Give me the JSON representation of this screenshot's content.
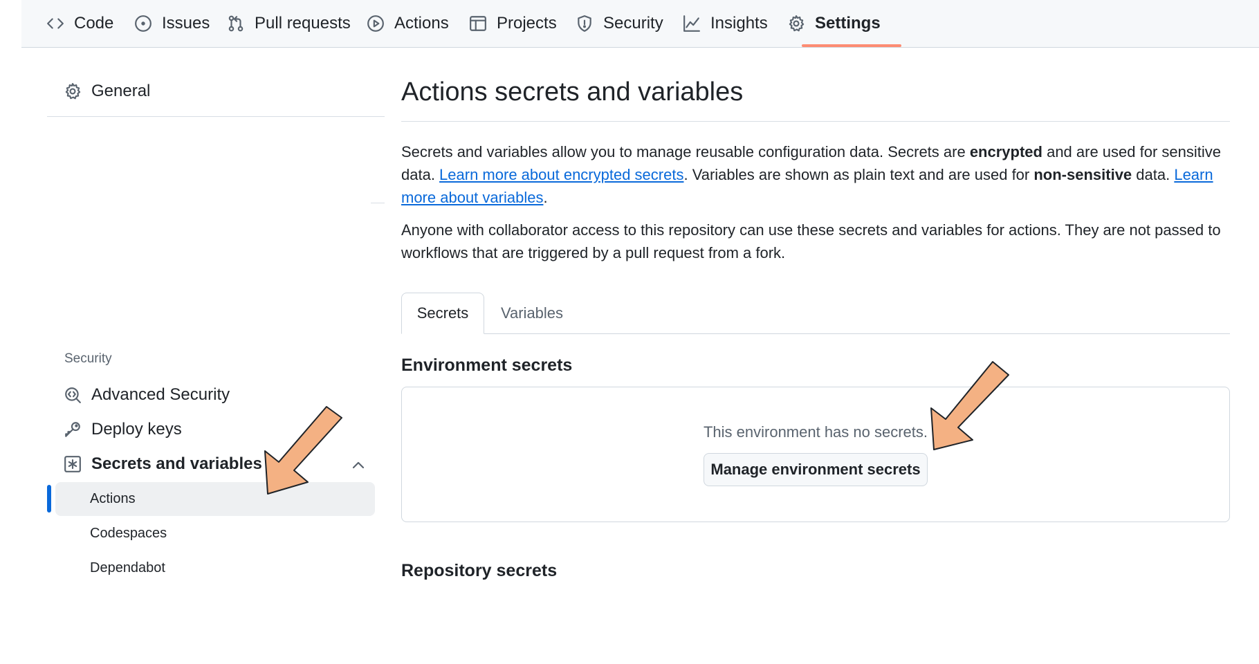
{
  "nav": {
    "items": [
      {
        "label": "Code",
        "icon": "code-icon"
      },
      {
        "label": "Issues",
        "icon": "issue-icon"
      },
      {
        "label": "Pull requests",
        "icon": "pull-request-icon"
      },
      {
        "label": "Actions",
        "icon": "play-icon"
      },
      {
        "label": "Projects",
        "icon": "table-icon"
      },
      {
        "label": "Security",
        "icon": "shield-icon"
      },
      {
        "label": "Insights",
        "icon": "graph-icon"
      },
      {
        "label": "Settings",
        "icon": "gear-icon",
        "selected": true
      }
    ],
    "selected_underline_color": "#fd8c73"
  },
  "sidebar": {
    "general": "General",
    "security_heading": "Security",
    "items": [
      {
        "label": "Advanced Security",
        "icon": "codescan-icon"
      },
      {
        "label": "Deploy keys",
        "icon": "key-icon"
      },
      {
        "label": "Secrets and variables",
        "icon": "asterisk-box-icon",
        "expanded": true
      }
    ],
    "subitems": [
      {
        "label": "Actions",
        "active": true
      },
      {
        "label": "Codespaces"
      },
      {
        "label": "Dependabot"
      }
    ]
  },
  "main": {
    "title": "Actions secrets and variables",
    "desc1": {
      "p1": "Secrets and variables allow you to manage reusable configuration data. Secrets are ",
      "b1": "encrypted",
      "p2": " and are used for sensitive data. ",
      "link1": "Learn more about encrypted secrets",
      "p3": ". Variables are shown as plain text and are used for ",
      "b2": "non-sensitive",
      "p4": " data. ",
      "link2": "Learn more about variables",
      "p5": "."
    },
    "desc2": "Anyone with collaborator access to this repository can use these secrets and variables for actions. They are not passed to workflows that are triggered by a pull request from a fork.",
    "tabs": [
      {
        "label": "Secrets",
        "active": true
      },
      {
        "label": "Variables"
      }
    ],
    "env_heading": "Environment secrets",
    "env_empty": "This environment has no secrets.",
    "env_button": "Manage environment secrets",
    "repo_heading": "Repository secrets"
  },
  "colors": {
    "accent_blue": "#0969da",
    "annotation_arrow": "#f4b183"
  }
}
